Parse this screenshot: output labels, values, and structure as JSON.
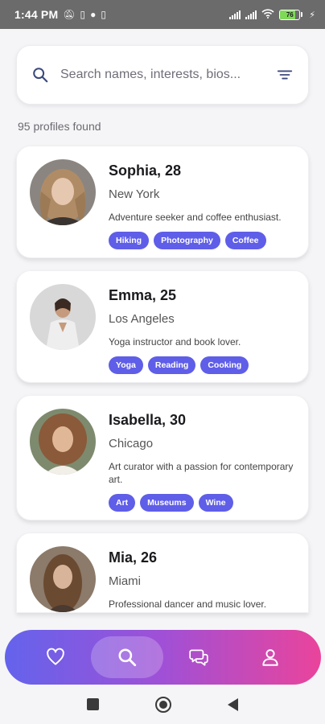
{
  "status_bar": {
    "time": "1:44 PM",
    "battery": "76",
    "icons": [
      "mute-icon",
      "sim-icon",
      "whatsapp-icon",
      "sim-icon",
      "signal-icon",
      "signal-icon",
      "wifi-icon",
      "battery-icon",
      "charging-icon"
    ]
  },
  "search": {
    "placeholder": "Search names, interests, bios...",
    "value": "",
    "icon": "search-icon",
    "filter_icon": "filter-icon"
  },
  "results": {
    "count_text": "95 profiles found"
  },
  "profiles": [
    {
      "name_age": "Sophia, 28",
      "city": "New York",
      "bio": "Adventure seeker and coffee enthusiast.",
      "tags": [
        "Hiking",
        "Photography",
        "Coffee"
      ]
    },
    {
      "name_age": "Emma, 25",
      "city": "Los Angeles",
      "bio": "Yoga instructor and book lover.",
      "tags": [
        "Yoga",
        "Reading",
        "Cooking"
      ]
    },
    {
      "name_age": "Isabella, 30",
      "city": "Chicago",
      "bio": "Art curator with a passion for contemporary art.",
      "tags": [
        "Art",
        "Museums",
        "Wine"
      ]
    },
    {
      "name_age": "Mia, 26",
      "city": "Miami",
      "bio": "Professional dancer and music lover.",
      "tags": []
    }
  ],
  "bottom_nav": {
    "items": [
      {
        "icon": "heart-icon",
        "active": false
      },
      {
        "icon": "search-icon",
        "active": true
      },
      {
        "icon": "chat-icon",
        "active": false
      },
      {
        "icon": "profile-icon",
        "active": false
      }
    ]
  },
  "colors": {
    "tag_bg": "#5f5ee8",
    "nav_gradient_start": "#6463ec",
    "nav_gradient_end": "#ea449b",
    "status_bar_bg": "#6b6b6b"
  }
}
